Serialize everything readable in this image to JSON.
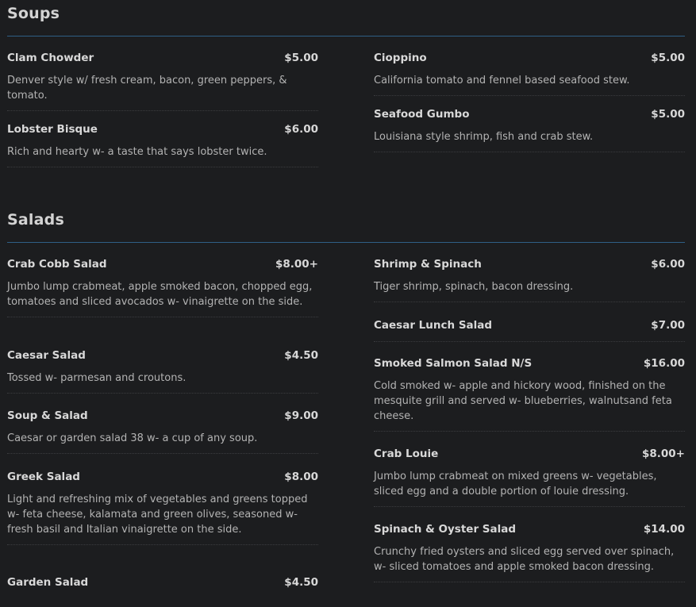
{
  "soups": {
    "title": "Soups",
    "left": [
      {
        "name": "Clam Chowder",
        "price": "$5.00",
        "desc": "Denver style w/ fresh cream, bacon, green peppers, & tomato."
      },
      {
        "name": "Lobster Bisque",
        "price": "$6.00",
        "desc": "Rich and hearty w- a taste that says lobster twice."
      }
    ],
    "right": [
      {
        "name": "Cioppino",
        "price": "$5.00",
        "desc": "California tomato and fennel based seafood stew."
      },
      {
        "name": "Seafood Gumbo",
        "price": "$5.00",
        "desc": "Louisiana style shrimp, fish and crab stew."
      }
    ]
  },
  "salads": {
    "title": "Salads",
    "left": [
      {
        "name": "Crab Cobb Salad",
        "price": "$8.00+",
        "desc": "Jumbo lump crabmeat, apple smoked bacon, chopped egg, tomatoes and sliced avocados w- vinaigrette on the side."
      },
      {
        "name": "Caesar Salad",
        "price": "$4.50",
        "desc": "Tossed w- parmesan and croutons."
      },
      {
        "name": "Soup & Salad",
        "price": "$9.00",
        "desc": "Caesar or garden salad 38 w- a cup of any soup."
      },
      {
        "name": "Greek Salad",
        "price": "$8.00",
        "desc": "Light and refreshing mix of vegetables and greens topped w- feta cheese, kalamata and green olives, seasoned w- fresh basil and Italian vinaigrette on the side."
      },
      {
        "name": "Garden Salad",
        "price": "$4.50",
        "desc": ""
      }
    ],
    "right": [
      {
        "name": "Shrimp & Spinach",
        "price": "$6.00",
        "desc": "Tiger shrimp, spinach, bacon dressing."
      },
      {
        "name": "Caesar Lunch Salad",
        "price": "$7.00",
        "desc": ""
      },
      {
        "name": "Smoked Salmon Salad N/S",
        "price": "$16.00",
        "desc": "Cold smoked w- apple and hickory wood, finished on the mesquite grill and served w- blueberries, walnutsand feta cheese."
      },
      {
        "name": "Crab Louie",
        "price": "$8.00+",
        "desc": "Jumbo lump crabmeat on mixed greens w- vegetables, sliced egg and a double portion of louie dressing."
      },
      {
        "name": "Spinach & Oyster Salad",
        "price": "$14.00",
        "desc": "Crunchy fried oysters and sliced egg served over spinach, w- sliced tomatoes and apple smoked bacon dressing."
      }
    ]
  }
}
